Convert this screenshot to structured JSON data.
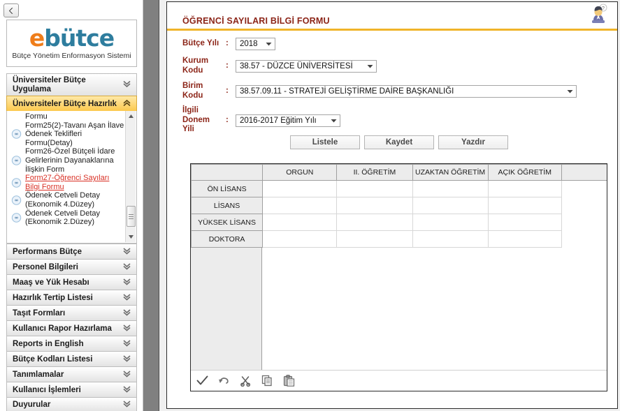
{
  "app": {
    "logo_e": "e",
    "logo_rest": "bütce",
    "logo_subtitle": "Bütçe Yönetim Enformasyon Sistemi",
    "back_button_label": "Geri",
    "accent_gold": "#f0b429",
    "title_color": "#8c2518",
    "label_color": "#8c2518",
    "selected_link_color": "#d93025",
    "splitter_color": "#808080"
  },
  "sidebar": {
    "accordions": [
      {
        "label": "Üniversiteler Bütçe Uygulama",
        "state": "collapsed",
        "chevron": "chevron-double-down-icon"
      },
      {
        "label": "Üniversiteler Bütçe Hazırlık",
        "state": "expanded",
        "chevron": "chevron-double-up-icon"
      }
    ],
    "tree_items": [
      {
        "label": "Formu",
        "selected": false,
        "has_bullet": false
      },
      {
        "label": "Form25(2)-Tavanı Aşan İlave Ödenek Teklifleri Formu(Detay)",
        "selected": false,
        "has_bullet": true
      },
      {
        "label": "Form26-Özel Bütçeli İdare Gelirlerinin Dayanaklarına İlişkin Form",
        "selected": false,
        "has_bullet": true
      },
      {
        "label": "Form27-Öğrenci Sayıları Bilgi Formu",
        "selected": true,
        "has_bullet": true
      },
      {
        "label": "Ödenek Cetveli Detay (Ekonomik 4.Düzey)",
        "selected": false,
        "has_bullet": true
      },
      {
        "label": "Ödenek Cetveli Detay (Ekonomik 2.Düzey)",
        "selected": false,
        "has_bullet": true
      }
    ],
    "lower_accordions": [
      {
        "label": "Performans Bütçe",
        "chevron": "chevron-double-down-icon"
      },
      {
        "label": "Personel Bilgileri",
        "chevron": "chevron-double-down-icon"
      },
      {
        "label": "Maaş ve Yük Hesabı",
        "chevron": "chevron-double-down-icon"
      },
      {
        "label": "Hazırlık Tertip Listesi",
        "chevron": "chevron-double-down-icon"
      },
      {
        "label": "Taşıt Formları",
        "chevron": "chevron-double-down-icon"
      },
      {
        "label": "Kullanıcı Rapor Hazırlama",
        "chevron": "chevron-double-down-icon"
      },
      {
        "label": "Reports in English",
        "chevron": "chevron-double-down-icon"
      },
      {
        "label": "Bütçe Kodları Listesi",
        "chevron": "chevron-double-down-icon"
      },
      {
        "label": "Tanımlamalar",
        "chevron": "chevron-double-down-icon"
      },
      {
        "label": "Kullanıcı İşlemleri",
        "chevron": "chevron-double-down-icon"
      },
      {
        "label": "Duyurular",
        "chevron": "chevron-double-down-icon"
      }
    ]
  },
  "main": {
    "form_title": "ÖĞRENCİ SAYILARI BİLGİ FORMU",
    "help_icon": "user-help-icon",
    "colon": ":",
    "fields": [
      {
        "label": "Bütçe Yılı",
        "value": "2018"
      },
      {
        "label": "Kurum Kodu",
        "label_l1": "Kurum",
        "label_l2": "Kodu",
        "value": "38.57 - DÜZCE ÜNİVERSİTESİ"
      },
      {
        "label": "Birim Kodu",
        "label_l1": "Birim",
        "label_l2": "Kodu",
        "value": "38.57.09.11 - STRATEJİ GELİŞTİRME DAİRE BAŞKANLIĞI"
      },
      {
        "label": "İlgili Donem Yili",
        "label_l1": "İlgili",
        "label_l2": "Donem",
        "label_l3": "Yili",
        "value": "2016-2017 Eğitim Yılı"
      }
    ],
    "buttons": [
      {
        "label": "Listele",
        "name": "list-button"
      },
      {
        "label": "Kaydet",
        "name": "save-button"
      },
      {
        "label": "Yazdır",
        "name": "print-button"
      }
    ],
    "grid": {
      "corner_header": "",
      "columns": [
        "ORGUN",
        "II. ÖĞRETİM",
        "UZAKTAN ÖĞRETİM",
        "AÇIK ÖĞRETİM"
      ],
      "rows": [
        {
          "header": "ÖN LİSANS",
          "cells": [
            "",
            "",
            "",
            ""
          ]
        },
        {
          "header": "LİSANS",
          "cells": [
            "",
            "",
            "",
            ""
          ]
        },
        {
          "header": "YÜKSEK LİSANS",
          "cells": [
            "",
            "",
            "",
            ""
          ]
        },
        {
          "header": "DOKTORA",
          "cells": [
            "",
            "",
            "",
            ""
          ]
        }
      ],
      "toolbar": [
        {
          "name": "confirm-check-icon",
          "label": "Onayla"
        },
        {
          "name": "undo-icon",
          "label": "Geri Al"
        },
        {
          "name": "cut-scissors-icon",
          "label": "Kes"
        },
        {
          "name": "copy-icon",
          "label": "Kopyala"
        },
        {
          "name": "paste-icon",
          "label": "Yapıştır"
        }
      ]
    }
  }
}
